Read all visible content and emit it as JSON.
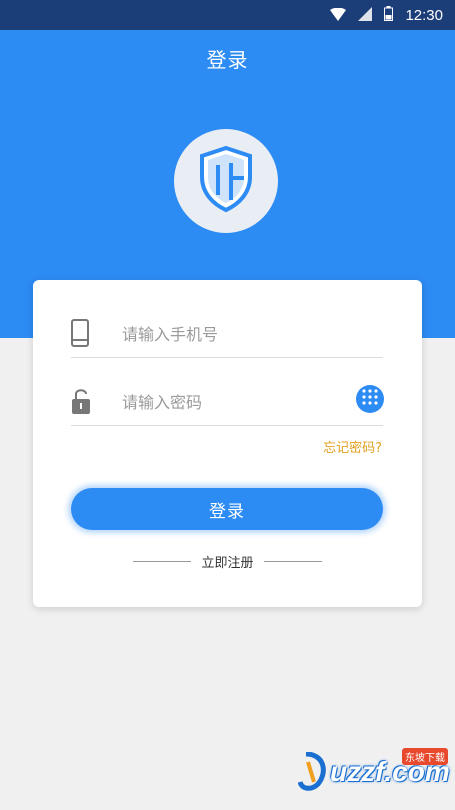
{
  "status_bar": {
    "time": "12:30"
  },
  "header": {
    "title": "登录",
    "logo_icon": "shield-icon"
  },
  "form": {
    "phone_placeholder": "请输入手机号",
    "password_placeholder": "请输入密码",
    "forgot_password": "忘记密码?",
    "login_button": "登录",
    "register_link": "立即注册"
  },
  "watermark": {
    "text": "uzzf.com",
    "badge": "东坡下载"
  },
  "colors": {
    "primary": "#2d8bf4",
    "status_bar": "#1c3e78",
    "forgot_link": "#e0a020",
    "background": "#f0f0f0"
  }
}
